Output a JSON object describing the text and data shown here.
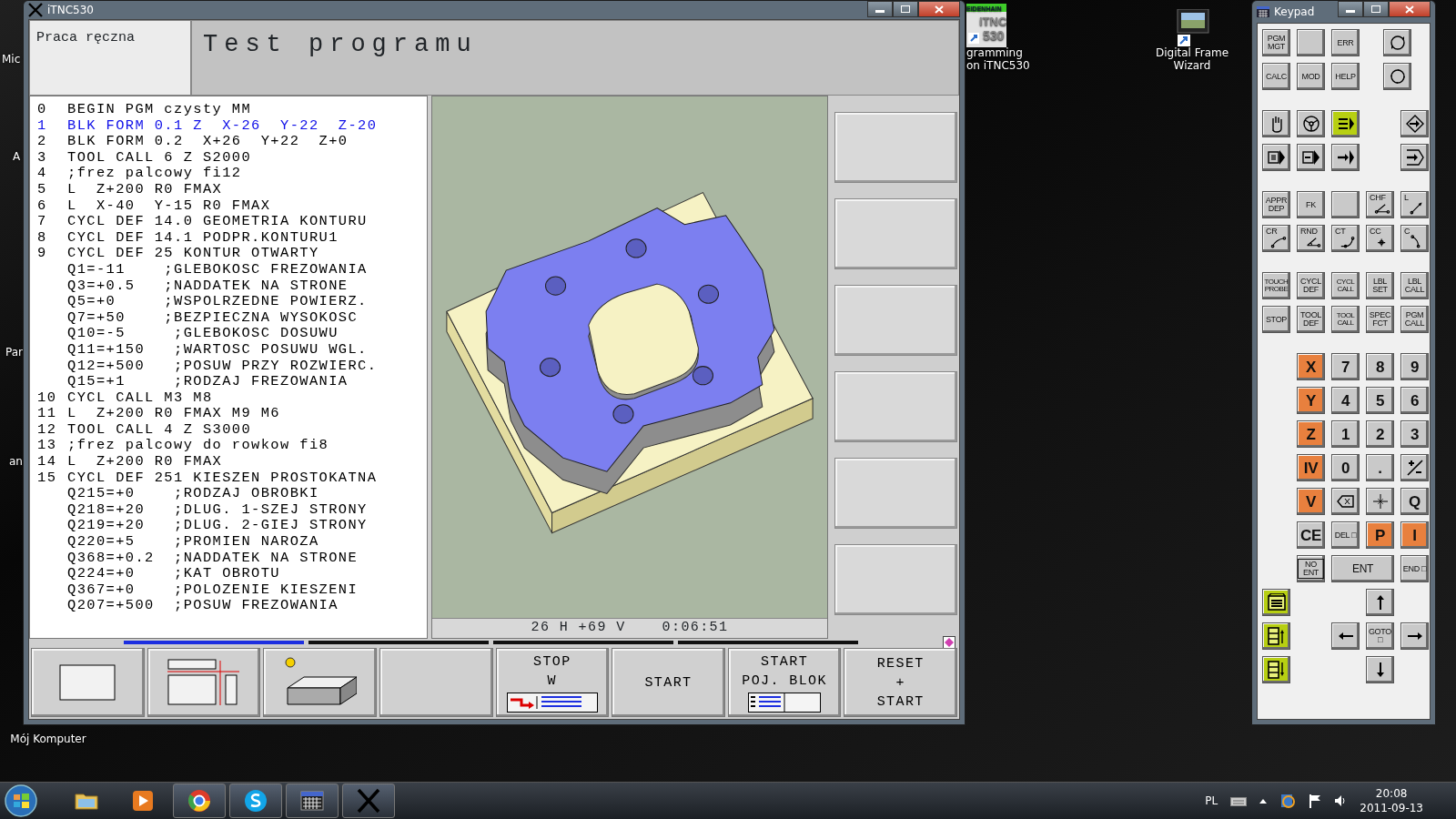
{
  "desktop": {
    "edge_labels": [
      "Mic",
      "A",
      "Par",
      "an"
    ],
    "icons": [
      {
        "kind": "computer",
        "lines": [
          "Mój Komputer"
        ]
      },
      {
        "kind": "itnc",
        "icon_texts": [
          "EIDENHAIN",
          "iTNC",
          "530"
        ],
        "lines": [
          "gramming",
          "on iTNC530"
        ]
      },
      {
        "kind": "frame",
        "lines": [
          "Digital Frame Wizard"
        ]
      }
    ]
  },
  "main_window": {
    "title": "iTNC530",
    "mode": "Praca ręczna",
    "operation": "Test programu",
    "program": [
      {
        "number": "0",
        "text": "BEGIN PGM czysty MM",
        "selected": false
      },
      {
        "number": "1",
        "text": "BLK FORM 0.1 Z  X-26  Y-22  Z-20",
        "selected": true
      },
      {
        "number": "2",
        "text": "BLK FORM 0.2  X+26  Y+22  Z+0",
        "selected": false
      },
      {
        "number": "3",
        "text": "TOOL CALL 6 Z S2000",
        "selected": false
      },
      {
        "number": "4",
        "text": ";frez palcowy fi12",
        "selected": false
      },
      {
        "number": "5",
        "text": "L  Z+200 R0 FMAX",
        "selected": false
      },
      {
        "number": "6",
        "text": "L  X-40  Y-15 R0 FMAX",
        "selected": false
      },
      {
        "number": "7",
        "text": "CYCL DEF 14.0 GEOMETRIA KONTURU",
        "selected": false
      },
      {
        "number": "8",
        "text": "CYCL DEF 14.1 PODPR.KONTURU1",
        "selected": false
      },
      {
        "number": "9",
        "text": "CYCL DEF 25 KONTUR OTWARTY",
        "selected": false
      },
      {
        "text": "Q1=-11    ;GLEBOKOSC FREZOWANIA",
        "selected": false
      },
      {
        "text": "Q3=+0.5   ;NADDATEK NA STRONE",
        "selected": false
      },
      {
        "text": "Q5=+0     ;WSPOLRZEDNE POWIERZ.",
        "selected": false
      },
      {
        "text": "Q7=+50    ;BEZPIECZNA WYSOKOSC",
        "selected": false
      },
      {
        "text": "Q10=-5     ;GLEBOKOSC DOSUWU",
        "selected": false
      },
      {
        "text": "Q11=+150   ;WARTOSC POSUWU WGL.",
        "selected": false
      },
      {
        "text": "Q12=+500   ;POSUW PRZY ROZWIERC.",
        "selected": false
      },
      {
        "text": "Q15=+1     ;RODZAJ FREZOWANIA",
        "selected": false
      },
      {
        "number": "10",
        "text": "CYCL CALL M3 M8",
        "selected": false
      },
      {
        "number": "11",
        "text": "L  Z+200 R0 FMAX M9 M6",
        "selected": false
      },
      {
        "number": "12",
        "text": "TOOL CALL 4 Z S3000",
        "selected": false
      },
      {
        "number": "13",
        "text": ";frez palcowy do rowkow fi8",
        "selected": false
      },
      {
        "number": "14",
        "text": "L  Z+200 R0 FMAX",
        "selected": false
      },
      {
        "number": "15",
        "text": "CYCL DEF 251 KIESZEN PROSTOKATNA",
        "selected": false
      },
      {
        "text": "Q215=+0    ;RODZAJ OBROBKI",
        "selected": false
      },
      {
        "text": "Q218=+20   ;DLUG. 1-SZEJ STRONY",
        "selected": false
      },
      {
        "text": "Q219=+20   ;DLUG. 2-GIEJ STRONY",
        "selected": false
      },
      {
        "text": "Q220=+5    ;PROMIEN NAROZA",
        "selected": false
      },
      {
        "text": "Q368=+0.2  ;NADDATEK NA STRONE",
        "selected": false
      },
      {
        "text": "Q224=+0    ;KAT OBROTU",
        "selected": false
      },
      {
        "text": "Q367=+0    ;POLOZENIE KIESZENI",
        "selected": false
      },
      {
        "text": "Q207=+500  ;POSUW FREZOWANIA",
        "selected": false
      }
    ],
    "graphic_status": {
      "view": "26 H +69 V",
      "time": "0:06:51"
    },
    "softkey_pages": [
      {
        "selected": true
      },
      {
        "selected": false
      },
      {
        "selected": false
      },
      {
        "selected": false
      }
    ],
    "softkeys": [
      {
        "kind": "icon"
      },
      {
        "kind": "icon"
      },
      {
        "kind": "icon"
      },
      {
        "kind": "blank"
      },
      {
        "kind": "text-icon",
        "lines": [
          "STOP",
          "W"
        ]
      },
      {
        "kind": "text",
        "lines": [
          "START"
        ]
      },
      {
        "kind": "text-icon",
        "lines": [
          "START",
          "POJ. BLOK"
        ]
      },
      {
        "kind": "text",
        "lines": [
          "RESET",
          "+",
          "START"
        ]
      }
    ]
  },
  "keypad": {
    "title": "Keypad",
    "groups": [
      [
        [
          {
            "kind": "text",
            "label": "PGM MGT",
            "color": "#c9c9c9"
          },
          {
            "kind": "blank",
            "color": "#c9c9c9"
          },
          {
            "kind": "text",
            "label": "ERR",
            "color": "#c9c9c9"
          },
          {
            "kind": "icon",
            "color": "#c9c9c9"
          }
        ],
        [
          {
            "kind": "text",
            "label": "CALC",
            "color": "#c9c9c9"
          },
          {
            "kind": "text",
            "label": "MOD",
            "color": "#c9c9c9"
          },
          {
            "kind": "text",
            "label": "HELP",
            "color": "#c9c9c9"
          },
          {
            "kind": "icon",
            "color": "#c9c9c9"
          }
        ]
      ],
      [
        [
          {
            "kind": "icon",
            "color": "#c9c9c9"
          },
          {
            "kind": "icon",
            "color": "#c9c9c9"
          },
          {
            "kind": "icon",
            "color": "#b7cf12"
          },
          {
            "kind": "icon",
            "color": "#c9c9c9"
          }
        ],
        [
          {
            "kind": "icon",
            "color": "#c9c9c9"
          },
          {
            "kind": "icon",
            "color": "#c9c9c9"
          },
          {
            "kind": "icon",
            "color": "#c9c9c9"
          },
          {
            "kind": "icon",
            "color": "#c9c9c9"
          }
        ]
      ],
      [
        [
          {
            "kind": "text",
            "label": "APPR DEP",
            "color": "#c9c9c9"
          },
          {
            "kind": "text",
            "label": "FK",
            "color": "#c9c9c9"
          },
          {
            "kind": "blank",
            "color": "#c9c9c9"
          },
          {
            "kind": "labeled",
            "label": "CHF",
            "color": "#c9c9c9"
          },
          {
            "kind": "labeled",
            "label": "L",
            "color": "#c9c9c9"
          }
        ],
        [
          {
            "kind": "labeled",
            "label": "CR",
            "color": "#c9c9c9"
          },
          {
            "kind": "labeled",
            "label": "RND",
            "color": "#c9c9c9"
          },
          {
            "kind": "labeled",
            "label": "CT",
            "color": "#c9c9c9"
          },
          {
            "kind": "labeled",
            "label": "CC",
            "color": "#c9c9c9"
          },
          {
            "kind": "labeled",
            "label": "C",
            "color": "#c9c9c9"
          }
        ]
      ],
      [
        [
          {
            "kind": "text",
            "label": "TOUCH PROBE",
            "color": "#c9c9c9"
          },
          {
            "kind": "text",
            "label": "CYCL DEF",
            "color": "#c9c9c9"
          },
          {
            "kind": "text",
            "label": "CYCL CALL",
            "color": "#c9c9c9"
          },
          {
            "kind": "text",
            "label": "LBL SET",
            "color": "#c9c9c9"
          },
          {
            "kind": "text",
            "label": "LBL CALL",
            "color": "#c9c9c9"
          }
        ],
        [
          {
            "kind": "text",
            "label": "STOP",
            "color": "#c9c9c9"
          },
          {
            "kind": "text",
            "label": "TOOL DEF",
            "color": "#c9c9c9"
          },
          {
            "kind": "text",
            "label": "TOOL CALL",
            "color": "#c9c9c9"
          },
          {
            "kind": "text",
            "label": "SPEC FCT",
            "color": "#c9c9c9"
          },
          {
            "kind": "text",
            "label": "PGM CALL",
            "color": "#c9c9c9"
          }
        ]
      ],
      [
        [
          {
            "kind": "big",
            "label": "X",
            "color": "#e8803e"
          },
          {
            "kind": "big",
            "label": "7",
            "color": "#c9c9c9"
          },
          {
            "kind": "big",
            "label": "8",
            "color": "#c9c9c9"
          },
          {
            "kind": "big",
            "label": "9",
            "color": "#c9c9c9"
          }
        ],
        [
          {
            "kind": "big",
            "label": "Y",
            "color": "#e8803e"
          },
          {
            "kind": "big",
            "label": "4",
            "color": "#c9c9c9"
          },
          {
            "kind": "big",
            "label": "5",
            "color": "#c9c9c9"
          },
          {
            "kind": "big",
            "label": "6",
            "color": "#c9c9c9"
          }
        ],
        [
          {
            "kind": "big",
            "label": "Z",
            "color": "#e8803e"
          },
          {
            "kind": "big",
            "label": "1",
            "color": "#c9c9c9"
          },
          {
            "kind": "big",
            "label": "2",
            "color": "#c9c9c9"
          },
          {
            "kind": "big",
            "label": "3",
            "color": "#c9c9c9"
          }
        ],
        [
          {
            "kind": "big",
            "label": "IV",
            "color": "#e8803e"
          },
          {
            "kind": "big",
            "label": "0",
            "color": "#c9c9c9"
          },
          {
            "kind": "big",
            "label": ".",
            "color": "#c9c9c9"
          },
          {
            "kind": "icon",
            "color": "#c9c9c9"
          }
        ],
        [
          {
            "kind": "big",
            "label": "V",
            "color": "#e8803e"
          },
          {
            "kind": "icon",
            "color": "#c9c9c9"
          },
          {
            "kind": "icon",
            "color": "#c9c9c9"
          },
          {
            "kind": "big",
            "label": "Q",
            "color": "#c9c9c9"
          }
        ],
        [
          {
            "kind": "big",
            "label": "CE",
            "color": "#c9c9c9"
          },
          {
            "kind": "text",
            "label": "DEL □",
            "color": "#c9c9c9"
          },
          {
            "kind": "big",
            "label": "P",
            "color": "#e8803e"
          },
          {
            "kind": "big",
            "label": "I",
            "color": "#e8803e"
          }
        ],
        [
          {
            "kind": "framed",
            "label": "NO ENT",
            "color": "#c9c9c9"
          },
          {
            "kind": "wide",
            "label": "ENT",
            "color": "#c9c9c9"
          },
          {
            "kind": "text",
            "label": "END □",
            "color": "#c9c9c9"
          }
        ],
        [
          {
            "kind": "icon",
            "color": "#b7cf12"
          },
          {
            "kind": "icon",
            "color": "#c9c9c9"
          }
        ],
        [
          {
            "kind": "icon",
            "color": "#b7cf12"
          },
          {
            "kind": "icon",
            "color": "#c9c9c9"
          },
          {
            "kind": "text",
            "label": "GOTO □",
            "color": "#c9c9c9"
          },
          {
            "kind": "icon",
            "color": "#c9c9c9"
          }
        ],
        [
          {
            "kind": "icon",
            "color": "#b7cf12"
          },
          {
            "kind": "icon",
            "color": "#c9c9c9"
          }
        ]
      ]
    ]
  },
  "taskbar": {
    "apps": [
      {
        "running": false
      },
      {
        "running": false
      },
      {
        "running": true
      },
      {
        "running": true
      },
      {
        "running": true
      },
      {
        "running": true
      }
    ],
    "tray": {
      "language": "PL",
      "time": "20:08",
      "date": "2011-09-13"
    }
  }
}
